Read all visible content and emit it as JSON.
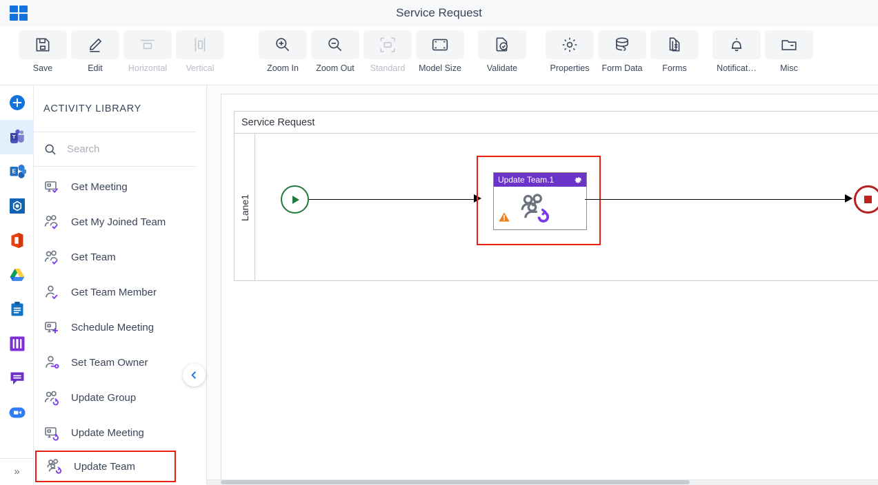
{
  "window": {
    "title": "Service Request",
    "app_launcher_icon": "app-grid-icon"
  },
  "ribbon": {
    "items": [
      {
        "label": "Save",
        "icon": "save-icon",
        "enabled": true
      },
      {
        "label": "Edit",
        "icon": "pencil-icon",
        "enabled": true
      },
      {
        "label": "Horizontal",
        "icon": "horizontal-align-icon",
        "enabled": false
      },
      {
        "label": "Vertical",
        "icon": "vertical-align-icon",
        "enabled": false
      },
      {
        "label": "Zoom In",
        "icon": "zoom-in-icon",
        "enabled": true
      },
      {
        "label": "Zoom Out",
        "icon": "zoom-out-icon",
        "enabled": true
      },
      {
        "label": "Standard",
        "icon": "standard-size-icon",
        "enabled": false
      },
      {
        "label": "Model Size",
        "icon": "model-size-icon",
        "enabled": true
      },
      {
        "label": "Validate",
        "icon": "validate-icon",
        "enabled": true
      },
      {
        "label": "Properties",
        "icon": "gear-icon",
        "enabled": true
      },
      {
        "label": "Form Data",
        "icon": "database-icon",
        "enabled": true
      },
      {
        "label": "Forms",
        "icon": "document-copy-icon",
        "enabled": true
      },
      {
        "label": "Notificat…",
        "icon": "bell-icon",
        "enabled": true
      },
      {
        "label": "Misc",
        "icon": "folder-icon",
        "enabled": true
      }
    ]
  },
  "rail": {
    "items": [
      {
        "name": "add-connector-button",
        "icon": "plus-circle-icon",
        "active": false
      },
      {
        "name": "microsoft-teams",
        "icon": "microsoft-teams-icon",
        "active": true
      },
      {
        "name": "microsoft-exchange",
        "icon": "microsoft-exchange-icon",
        "active": false
      },
      {
        "name": "sharepoint",
        "icon": "sharepoint-icon",
        "active": false
      },
      {
        "name": "microsoft-office",
        "icon": "microsoft-office-icon",
        "active": false
      },
      {
        "name": "google-drive",
        "icon": "google-drive-icon",
        "active": false
      },
      {
        "name": "planner",
        "icon": "clipboard-icon",
        "active": false
      },
      {
        "name": "jira",
        "icon": "jira-icon",
        "active": false
      },
      {
        "name": "chat",
        "icon": "chat-bubble-icon",
        "active": false
      },
      {
        "name": "zoom",
        "icon": "video-camera-icon",
        "active": false
      }
    ],
    "expand_label": "»"
  },
  "panel": {
    "title": "ACTIVITY LIBRARY",
    "search": {
      "value": "",
      "placeholder": "Search",
      "icon": "search-icon"
    },
    "collapse_icon": "chevron-left-icon",
    "items": [
      {
        "label": "Get Meeting",
        "icon": "meeting-check-icon",
        "selected": false
      },
      {
        "label": "Get My Joined Team",
        "icon": "person-check-icon",
        "selected": false
      },
      {
        "label": "Get Team",
        "icon": "team-check-icon",
        "selected": false
      },
      {
        "label": "Get Team Member",
        "icon": "single-person-check-icon",
        "selected": false
      },
      {
        "label": "Schedule Meeting",
        "icon": "meeting-plus-icon",
        "selected": false
      },
      {
        "label": "Set Team Owner",
        "icon": "person-key-icon",
        "selected": false
      },
      {
        "label": "Update Group",
        "icon": "group-refresh-icon",
        "selected": false
      },
      {
        "label": "Update Meeting",
        "icon": "meeting-refresh-icon",
        "selected": false
      },
      {
        "label": "Update Team",
        "icon": "team-refresh-icon",
        "selected": true
      }
    ]
  },
  "canvas": {
    "pool_name": "Service Request",
    "lane_name": "Lane1",
    "start_event": {
      "name": "start-event",
      "icon": "play-icon"
    },
    "end_event": {
      "name": "end-event",
      "icon": "stop-square-icon"
    },
    "task": {
      "name": "Update Team.1",
      "header_color": "#6b34c8",
      "gear_icon": "gear-icon",
      "activity_icon": "team-refresh-icon",
      "warning_icon": "warning-triangle-icon",
      "selected": true,
      "selection_color": "#e81e13"
    },
    "flows": [
      {
        "from": "start-event",
        "to": "Update Team.1"
      },
      {
        "from": "Update Team.1",
        "to": "end-event"
      }
    ]
  },
  "colors": {
    "accent": "#1273de",
    "task_purple": "#6b34c8",
    "selection_red": "#e81e13",
    "start_green": "#1e7a3c",
    "end_red": "#b32020",
    "warning_orange": "#e8821e"
  }
}
